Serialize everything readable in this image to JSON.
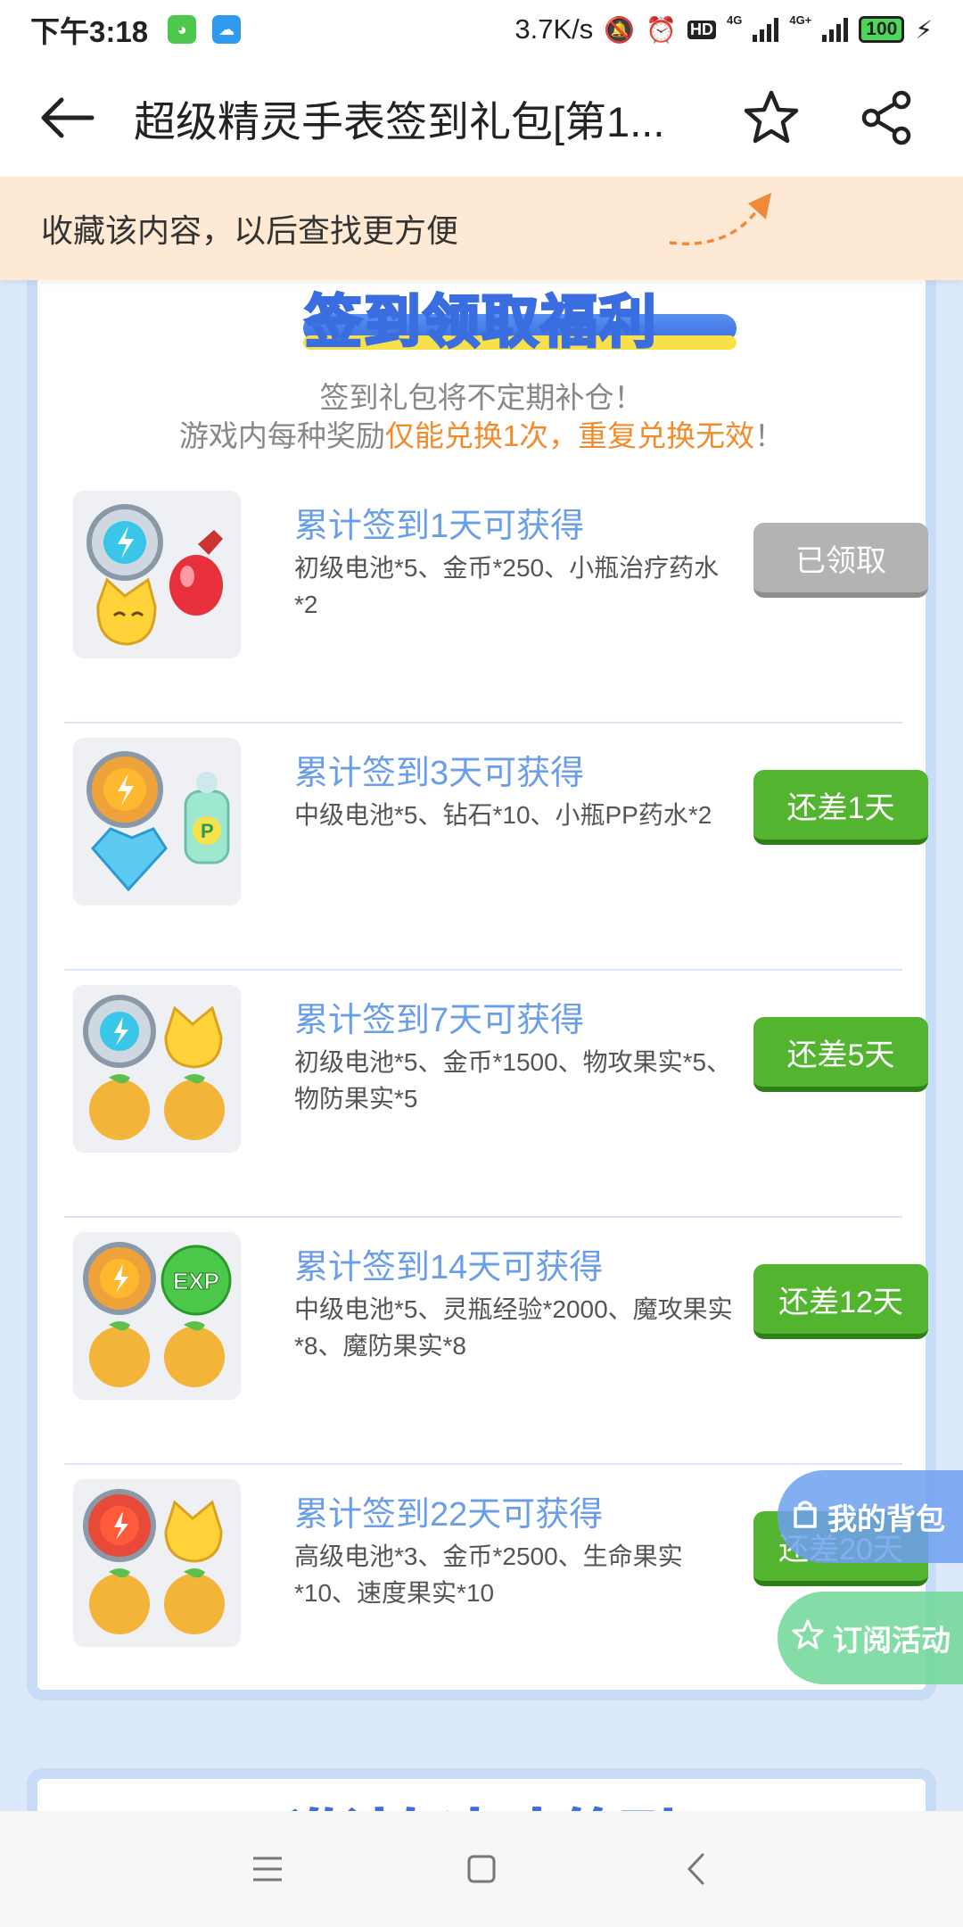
{
  "status_bar": {
    "time": "下午3:18",
    "net_speed": "3.7K/s",
    "sim1": "4G",
    "sim2": "4G+",
    "battery": "100"
  },
  "header": {
    "title": "超级精灵手表签到礼包[第1..."
  },
  "tip": {
    "text": "收藏该内容，以后查找更方便"
  },
  "section": {
    "title": "签到领取福利",
    "subtitle_line1": "签到礼包将不定期补仓！",
    "subtitle_line2_prefix": "游戏内每种奖励",
    "subtitle_line2_highlight": "仅能兑换1次，重复兑换无效",
    "subtitle_line2_suffix": "！"
  },
  "rewards": [
    {
      "title": "累计签到1天可获得",
      "desc": "初级电池*5、金币*250、小瓶治疗药水*2",
      "button": "已领取",
      "state": "claimed"
    },
    {
      "title": "累计签到3天可获得",
      "desc": "中级电池*5、钻石*10、小瓶PP药水*2",
      "button": "还差1天",
      "state": "pending"
    },
    {
      "title": "累计签到7天可获得",
      "desc": "初级电池*5、金币*1500、物攻果实*5、物防果实*5",
      "button": "还差5天",
      "state": "pending"
    },
    {
      "title": "累计签到14天可获得",
      "desc": "中级电池*5、灵瓶经验*2000、魔攻果实*8、魔防果实*8",
      "button": "还差12天",
      "state": "pending"
    },
    {
      "title": "累计签到22天可获得",
      "desc": "高级电池*3、金币*2500、生命果实*10、速度果实*10",
      "button": "还差20天",
      "state": "pending"
    }
  ],
  "next_section": {
    "title": "邀请好友来签到"
  },
  "floating": {
    "bag": "我的背包",
    "subscribe": "订阅活动"
  },
  "colors": {
    "accent_blue": "#6a9ee8",
    "claimed_gray": "#b3b3b3",
    "pending_green": "#53b42f",
    "highlight_orange": "#f28b2c",
    "tip_bg": "#fde9d4"
  }
}
